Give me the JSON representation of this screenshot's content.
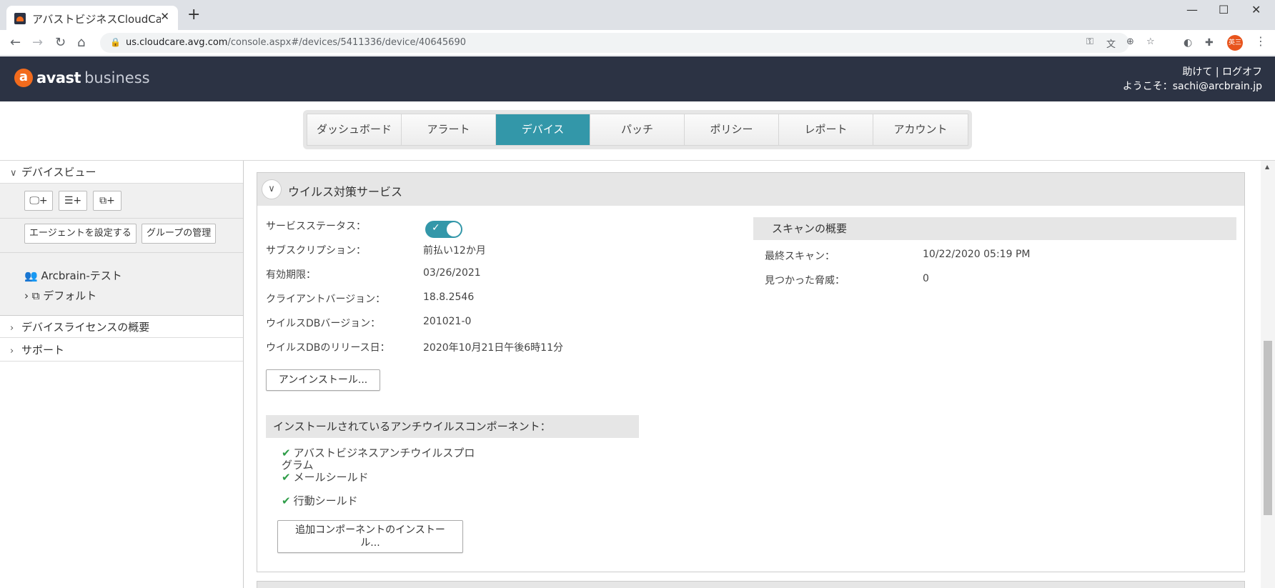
{
  "browser": {
    "tab_title": "アバストビジネスCloudCare",
    "url_host": "us.cloudcare.avg.com",
    "url_path": "/console.aspx#/devices/5411336/device/40645690",
    "profile_label": "英三"
  },
  "header": {
    "logo_word": "avast",
    "logo_sub": "business",
    "help_link": "助けて",
    "logoff_link": "ログオフ",
    "welcome": "ようこそ：sachi@arcbrain.jp"
  },
  "nav": {
    "tabs": [
      {
        "label": "ダッシュボード"
      },
      {
        "label": "アラート"
      },
      {
        "label": "デバイス"
      },
      {
        "label": "パッチ"
      },
      {
        "label": "ポリシー"
      },
      {
        "label": "レポート"
      },
      {
        "label": "アカウント"
      }
    ],
    "active_index": 2
  },
  "sidebar": {
    "device_view": "デバイスビュー",
    "set_agent_btn": "エージェントを設定する",
    "manage_groups_btn": "グループの管理",
    "tree_root": "Arcbrain-テスト",
    "tree_child": "デフォルト",
    "license_overview": "デバイスライセンスの概要",
    "support": "サポート"
  },
  "antivirus": {
    "title": "ウイルス対策サービス",
    "service_status_label": "サービスステータス：",
    "service_enabled": true,
    "subscription_label": "サブスクリプション：",
    "subscription_value": "前払い12か月",
    "expiry_label": "有効期限：",
    "expiry_value": "03/26/2021",
    "client_version_label": "クライアントバージョン：",
    "client_version_value": "18.8.2546",
    "virus_db_label": "ウイルスDBバージョン：",
    "virus_db_value": "201021-0",
    "virus_db_release_label": "ウイルスDBのリリース日：",
    "virus_db_release_value": "2020年10月21日午後6時11分",
    "uninstall_btn": "アンインストール...",
    "installed_components_title": "インストールされているアンチウイルスコンポーネント：",
    "components": [
      "アバストビジネスアンチウイルスプログラム",
      "メールシールド",
      "行動シールド"
    ],
    "install_more_btn": "追加コンポーネントのインストール..."
  },
  "scan_summary": {
    "title": "スキャンの概要",
    "last_scan_label": "最終スキャン：",
    "last_scan_value": "10/22/2020 05:19 PM",
    "threats_label": "見つかった脅威：",
    "threats_value": "0"
  },
  "colors": {
    "header_bg": "#2c3344",
    "accent": "#3397a9",
    "brand_orange": "#f26b1d",
    "check_green": "#2e9d48"
  }
}
